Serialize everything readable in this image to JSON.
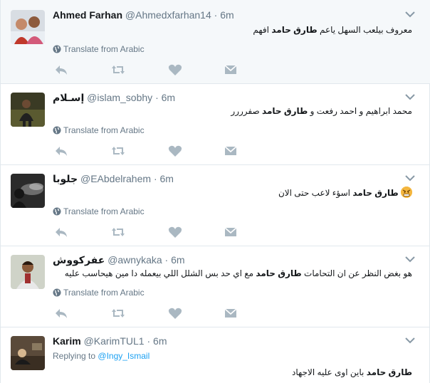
{
  "tweets": [
    {
      "name": "Ahmed Farhan",
      "handle": "@Ahmedxfarhan14",
      "time": "6m",
      "text_pre": "معروف بيلعب السهل ياعم ",
      "text_bold": "طارق حامد",
      "text_post": " افهم",
      "translate": "Translate from Arabic"
    },
    {
      "name": "إسـلام",
      "handle": "@islam_sobhy",
      "time": "6m",
      "text_pre": "محمد ابراهيم و احمد رفعت و ",
      "text_bold": "طارق حامد",
      "text_post": " صفرررر",
      "translate": "Translate from Arabic"
    },
    {
      "name": "جلوبا",
      "handle": "@EAbdelrahem",
      "time": "6m",
      "text_pre": "",
      "text_bold": "طارق حامد",
      "text_post": " اسؤء لاعب حتى الان",
      "translate": "Translate from Arabic"
    },
    {
      "name": "عفركووش",
      "handle": "@awnykaka",
      "time": "6m",
      "text_pre": "هو بغض النظر عن ان التحامات ",
      "text_bold": "طارق حامد",
      "text_post": " مع اي حد بس الشلل اللي بيعمله دا مين هيحاسب عليه",
      "translate": "Translate from Arabic"
    },
    {
      "name": "Karim",
      "handle": "@KarimTUL1",
      "time": "6m",
      "replying_label": "Replying to",
      "replying_to": "@Ingy_Ismail",
      "text_pre": "",
      "text_bold": "طارق حامد",
      "text_post": " باين اوى عليه الاجهاد"
    }
  ],
  "dot": "·",
  "icons": [
    "reply-icon",
    "retweet-icon",
    "like-icon",
    "message-icon",
    "globe-icon",
    "caret-down-icon"
  ],
  "colors": {
    "accent": "#1da1f2",
    "muted": "#657786",
    "icon": "#aab8c2",
    "highlight": "#f5f8fa"
  }
}
